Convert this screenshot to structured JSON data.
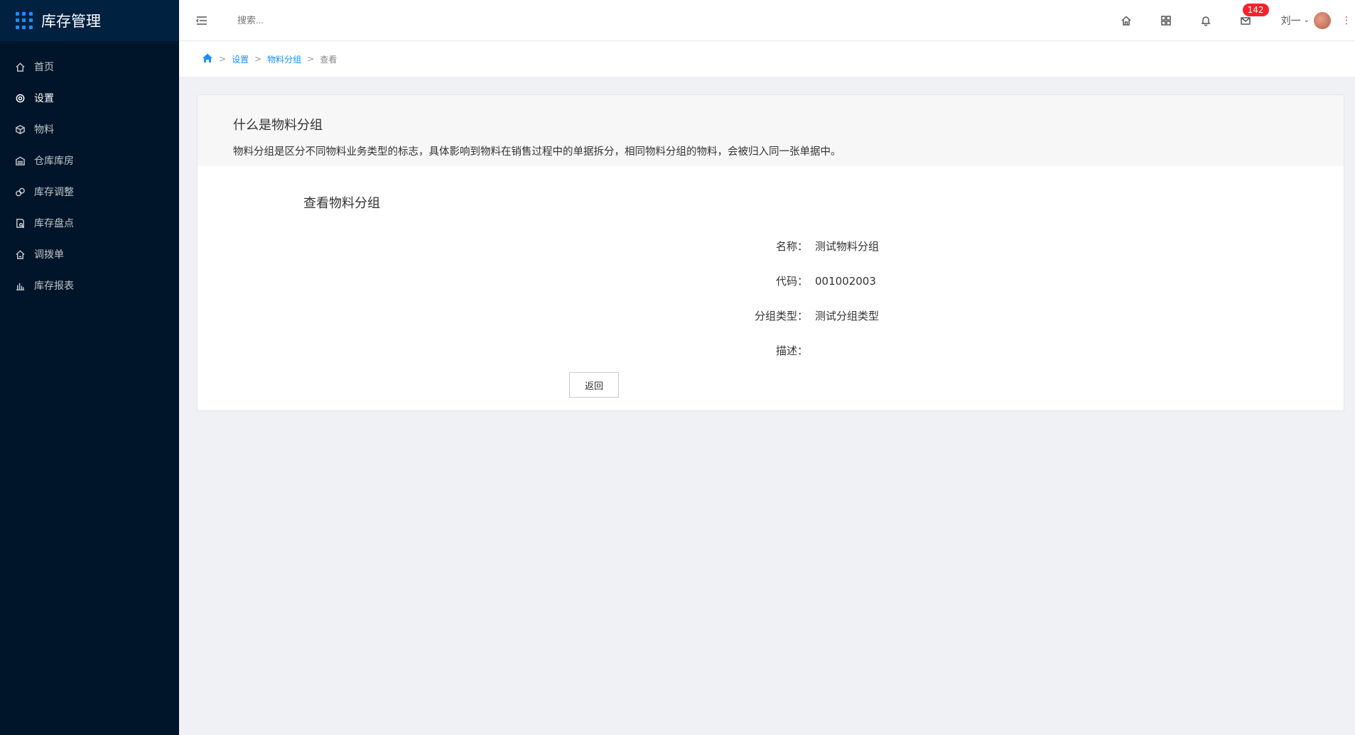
{
  "app": {
    "title": "库存管理"
  },
  "sidebar": {
    "items": [
      {
        "label": "首页",
        "icon": "home-icon"
      },
      {
        "label": "设置",
        "icon": "gear-icon"
      },
      {
        "label": "物料",
        "icon": "cube-icon"
      },
      {
        "label": "仓库库房",
        "icon": "warehouse-icon"
      },
      {
        "label": "库存调整",
        "icon": "adjust-icon"
      },
      {
        "label": "库存盘点",
        "icon": "inventory-icon"
      },
      {
        "label": "调拨单",
        "icon": "transfer-icon"
      },
      {
        "label": "库存报表",
        "icon": "bar-chart-icon"
      }
    ],
    "active_index": 1
  },
  "header": {
    "search_placeholder": "搜索...",
    "message_count": "142",
    "user_name": "刘一"
  },
  "breadcrumb": {
    "items": [
      "设置",
      "物料分组"
    ],
    "current": "查看"
  },
  "intro": {
    "title": "什么是物料分组",
    "text": "物料分组是区分不同物料业务类型的标志，具体影响到物料在销售过程中的单据拆分，相同物料分组的物料，会被归入同一张单据中。"
  },
  "view": {
    "title": "查看物料分组",
    "fields": [
      {
        "label": "名称：",
        "value": "测试物料分组"
      },
      {
        "label": "代码：",
        "value": "001002003"
      },
      {
        "label": "分组类型：",
        "value": "测试分组类型"
      },
      {
        "label": "描述：",
        "value": ""
      }
    ],
    "back_button": "返回"
  },
  "colors": {
    "sidebar_bg": "#001529",
    "accent": "#1890ff",
    "badge": "#f5222d"
  }
}
